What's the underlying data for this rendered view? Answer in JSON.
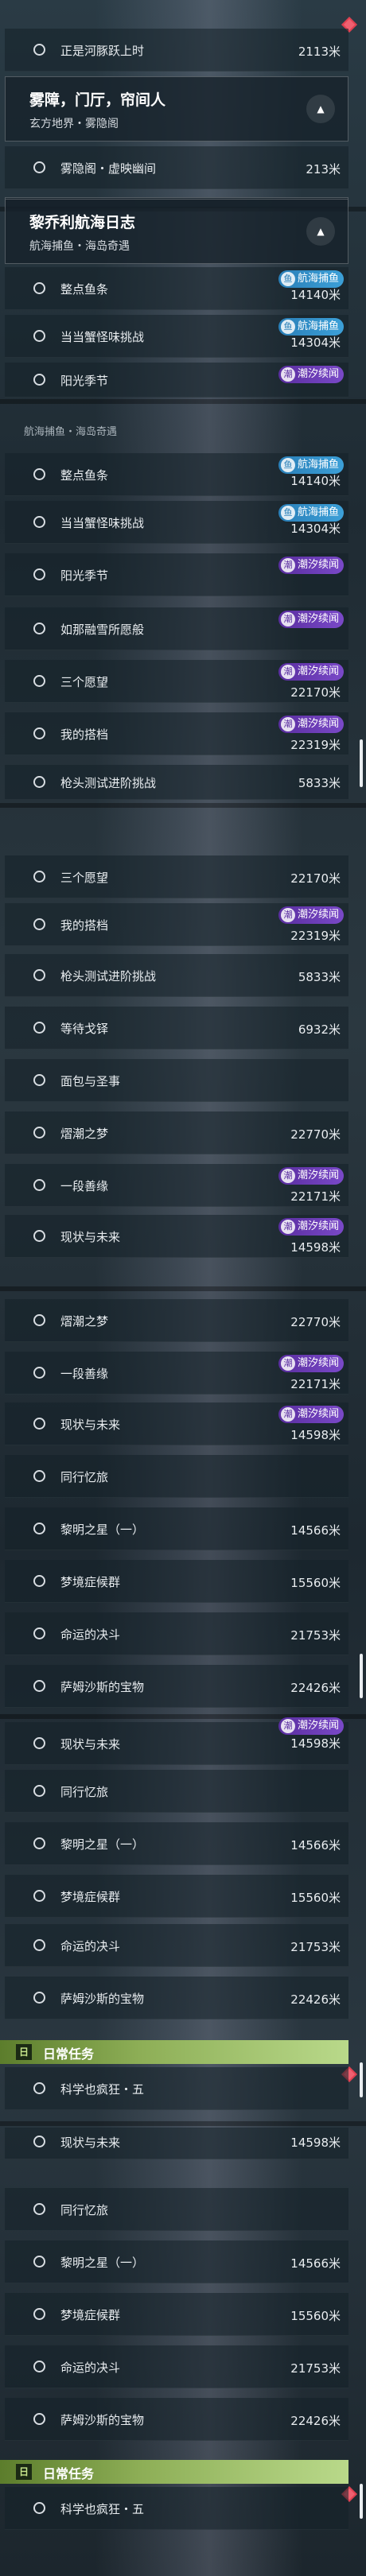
{
  "tasks": {
    "hepanyue": "正是河豚跃上时",
    "wuyinge": "雾隐阁・虚映幽间",
    "zhengdian": "整点鱼条",
    "dangdang": "当当蟹怪味挑战",
    "yangguang": "阳光季节",
    "runaling": "如那融雪所愿般",
    "sange": "三个愿望",
    "wodedaping": "我的搭档",
    "qiangtou": "枪头测试进阶挑战",
    "dengdai": "等待戈铎",
    "mianbao": "面包与圣事",
    "xichao": "熠潮之梦",
    "yiduan": "一段善缘",
    "xianzhuang": "现状与未来",
    "tongxing": "同行忆旅",
    "liming": "黎明之星（一）",
    "mengjing": "梦境症候群",
    "mingyun": "命运的决斗",
    "samu": "萨姆沙斯的宝物",
    "kexue": "科学也疯狂・五"
  },
  "distances": {
    "hepanyue": "2113米",
    "wuyinge": "213米",
    "zhengdian": "14140米",
    "dangdang": "14304米",
    "sange": "22170米",
    "wodedaping": "22319米",
    "qiangtou": "5833米",
    "dengdai": "6932米",
    "xichao": "22770米",
    "yiduan": "22171米",
    "xianzhuang": "14598米",
    "liming": "14566米",
    "mengjing": "15560米",
    "mingyun": "21753米",
    "samu": "22426米"
  },
  "badges": {
    "hanghai": "航海捕鱼",
    "chaoxi": "潮汐续闻"
  },
  "groups": {
    "wuzhang": {
      "title": "雾障，门厅，帘间人",
      "subtitle": "玄方地界・雾隐阁"
    },
    "liqiaoli": {
      "title": "黎乔利航海日志",
      "subtitle": "航海捕鱼・海岛奇遇"
    },
    "daily": {
      "title": "日常任务"
    }
  },
  "cut_text": "航海捕鱼・海岛奇遇",
  "icons": {
    "collapse": "chevron-up-icon",
    "daily": "daily-task-icon",
    "tracked": "diamond-marker-icon",
    "badge_hanghai": "fishing-icon",
    "badge_chaoxi": "tide-icon"
  },
  "colors": {
    "purple_badge": "#6a3bb4",
    "blue_badge": "#3291c8",
    "daily_bar": "#8dae56",
    "marker": "#e04050"
  }
}
